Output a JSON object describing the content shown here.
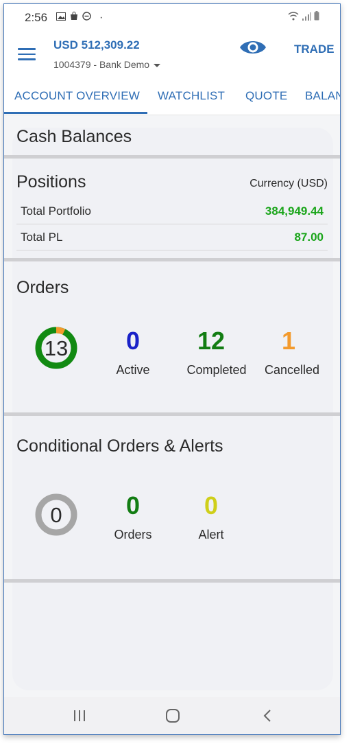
{
  "statusbar": {
    "time": "2:56",
    "dot": "·"
  },
  "header": {
    "balance": "USD 512,309.22",
    "account": "1004379 - Bank Demo",
    "trade_label": "TRADE"
  },
  "tabs": [
    {
      "label": "ACCOUNT OVERVIEW"
    },
    {
      "label": "WATCHLIST"
    },
    {
      "label": "QUOTE"
    },
    {
      "label": "BALAN"
    }
  ],
  "cash_balances": {
    "title": "Cash Balances"
  },
  "positions": {
    "title": "Positions",
    "currency": "Currency (USD)",
    "rows": [
      {
        "label": "Total Portfolio",
        "value": "384,949.44"
      },
      {
        "label": "Total PL",
        "value": "87.00"
      }
    ]
  },
  "orders": {
    "title": "Orders",
    "total": "13",
    "stats": [
      {
        "value": "0",
        "label": "Active",
        "color": "#1a22c8"
      },
      {
        "value": "12",
        "label": "Completed",
        "color": "#137d13"
      },
      {
        "value": "1",
        "label": "Cancelled",
        "color": "#f39a2c"
      }
    ]
  },
  "conditional": {
    "title": "Conditional Orders & Alerts",
    "total": "0",
    "stats": [
      {
        "value": "0",
        "label": "Orders",
        "color": "#137d13"
      },
      {
        "value": "0",
        "label": "Alert",
        "color": "#cfcf1a"
      }
    ]
  },
  "colors": {
    "accent": "#2f6eb5",
    "positive": "#1aa51a",
    "donut_green": "#128a12",
    "donut_orange": "#f39a2c",
    "donut_gray": "#a6a6a6"
  }
}
